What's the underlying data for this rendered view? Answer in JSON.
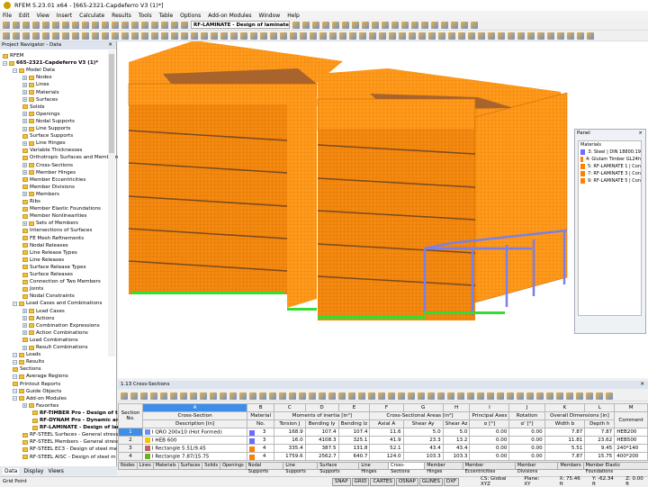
{
  "window": {
    "title": "RFEM 5.23.01 x64 - [665-2321-Capdeferro V3 (1)*]"
  },
  "menu": [
    "File",
    "Edit",
    "View",
    "Insert",
    "Calculate",
    "Results",
    "Tools",
    "Table",
    "Options",
    "Add-on Modules",
    "Window",
    "Help"
  ],
  "toolbar": {
    "module_select": "RF-LAMINATE - Design of laminate surf"
  },
  "navigator": {
    "title": "Project Navigator - Data",
    "tabs": [
      "Data",
      "Display",
      "Views"
    ],
    "tree": [
      {
        "l": 0,
        "t": "RFEM"
      },
      {
        "l": 0,
        "t": "665-2321-Capdeferro V3 (1)*",
        "b": true,
        "e": 1
      },
      {
        "l": 1,
        "t": "Model Data",
        "e": 1
      },
      {
        "l": 2,
        "t": "Nodes",
        "e": 1
      },
      {
        "l": 2,
        "t": "Lines",
        "e": 1
      },
      {
        "l": 2,
        "t": "Materials",
        "e": 1
      },
      {
        "l": 2,
        "t": "Surfaces",
        "e": 1
      },
      {
        "l": 2,
        "t": "Solids"
      },
      {
        "l": 2,
        "t": "Openings",
        "e": 1
      },
      {
        "l": 2,
        "t": "Nodal Supports",
        "e": 1
      },
      {
        "l": 2,
        "t": "Line Supports",
        "e": 1
      },
      {
        "l": 2,
        "t": "Surface Supports"
      },
      {
        "l": 2,
        "t": "Line Hinges",
        "e": 1
      },
      {
        "l": 2,
        "t": "Variable Thicknesses"
      },
      {
        "l": 2,
        "t": "Orthotropic Surfaces and Membranes"
      },
      {
        "l": 2,
        "t": "Cross-Sections",
        "e": 1
      },
      {
        "l": 2,
        "t": "Member Hinges",
        "e": 1
      },
      {
        "l": 2,
        "t": "Member Eccentricities"
      },
      {
        "l": 2,
        "t": "Member Divisions"
      },
      {
        "l": 2,
        "t": "Members",
        "e": 1
      },
      {
        "l": 2,
        "t": "Ribs"
      },
      {
        "l": 2,
        "t": "Member Elastic Foundations"
      },
      {
        "l": 2,
        "t": "Member Nonlinearities"
      },
      {
        "l": 2,
        "t": "Sets of Members",
        "e": 1
      },
      {
        "l": 2,
        "t": "Intersections of Surfaces"
      },
      {
        "l": 2,
        "t": "FE Mesh Refinements"
      },
      {
        "l": 2,
        "t": "Nodal Releases"
      },
      {
        "l": 2,
        "t": "Line Release Types"
      },
      {
        "l": 2,
        "t": "Line Releases"
      },
      {
        "l": 2,
        "t": "Surface Release Types"
      },
      {
        "l": 2,
        "t": "Surface Releases"
      },
      {
        "l": 2,
        "t": "Connection of Two Members"
      },
      {
        "l": 2,
        "t": "Joints"
      },
      {
        "l": 2,
        "t": "Nodal Constraints"
      },
      {
        "l": 1,
        "t": "Load Cases and Combinations",
        "e": 1
      },
      {
        "l": 2,
        "t": "Load Cases",
        "e": 1
      },
      {
        "l": 2,
        "t": "Actions",
        "e": 1
      },
      {
        "l": 2,
        "t": "Combination Expressions",
        "e": 1
      },
      {
        "l": 2,
        "t": "Action Combinations",
        "e": 1
      },
      {
        "l": 2,
        "t": "Load Combinations"
      },
      {
        "l": 2,
        "t": "Result Combinations",
        "e": 1
      },
      {
        "l": 1,
        "t": "Loads",
        "e": 1
      },
      {
        "l": 1,
        "t": "Results",
        "e": 1
      },
      {
        "l": 1,
        "t": "Sections"
      },
      {
        "l": 1,
        "t": "Average Regions",
        "e": 1
      },
      {
        "l": 1,
        "t": "Printout Reports"
      },
      {
        "l": 1,
        "t": "Guide Objects",
        "e": 1
      },
      {
        "l": 1,
        "t": "Add-on Modules",
        "e": 1
      },
      {
        "l": 2,
        "t": "Favorites",
        "e": 1
      },
      {
        "l": 3,
        "t": "RF-TIMBER Pro - Design of timber",
        "b": true
      },
      {
        "l": 3,
        "t": "RF-DYNAM Pro - Dynamic analysis",
        "b": true
      },
      {
        "l": 3,
        "t": "RF-LAMINATE - Design of laminate",
        "b": true
      },
      {
        "l": 2,
        "t": "RF-STEEL Surfaces - General stress"
      },
      {
        "l": 2,
        "t": "RF-STEEL Members - General stress"
      },
      {
        "l": 2,
        "t": "RF-STEEL EC3 - Design of steel me"
      },
      {
        "l": 2,
        "t": "RF-STEEL AISC - Design of steel m"
      }
    ]
  },
  "panel": {
    "title": "Panel",
    "section": "Materials",
    "items": [
      {
        "label": "3: Steel | DIN 18800:19",
        "color": "#6b6bff"
      },
      {
        "label": "4: Glulam Timber GL24h",
        "color": "#ff8000"
      },
      {
        "label": "5: RF-LAMINATE 1 | Con",
        "color": "#ff8000"
      },
      {
        "label": "7: RF-LAMINATE 3 | Con",
        "color": "#ff8000"
      },
      {
        "label": "9: RF-LAMINATE 5 | Con",
        "color": "#ff8000"
      }
    ]
  },
  "table": {
    "title": "1.13 Cross-Sections",
    "letters": [
      "A",
      "B",
      "C",
      "D",
      "E",
      "F",
      "G",
      "H",
      "I",
      "J",
      "K",
      "L",
      "M"
    ],
    "groups": [
      "Section No.",
      "Cross-Section",
      "Material",
      "Moments of inertia [in⁴]",
      "Cross-Sectional Areas [in²]",
      "Principal Axes",
      "Rotation",
      "Overall Dimensions [in]",
      ""
    ],
    "subheaders": [
      "Description [in]",
      "No.",
      "Torsion J",
      "Bending Iy",
      "Bending Iz",
      "Axial A",
      "Shear Ay",
      "Shear Az",
      "α [°]",
      "α' [°]",
      "Width b",
      "Depth h",
      "Comment"
    ],
    "rows": [
      {
        "no": "1",
        "desc": "QRO 200x10 (Hot Formed)",
        "color": "#6e8ff0",
        "mat": "3",
        "matcolor": "#6b6bff",
        "v": [
          "168.9",
          "107.4",
          "107.4",
          "11.6",
          "5.0",
          "5.0",
          "0.00",
          "0.00",
          "7.87",
          "7.87",
          "HEB200"
        ]
      },
      {
        "no": "2",
        "desc": "HEB 600",
        "color": "#f5c400",
        "mat": "3",
        "matcolor": "#6b6bff",
        "v": [
          "16.0",
          "4108.3",
          "325.1",
          "41.9",
          "23.3",
          "13.2",
          "0.00",
          "0.00",
          "11.81",
          "23.62",
          "HEB500"
        ]
      },
      {
        "no": "3",
        "desc": "Rectangle 5.51/9.45",
        "color": "#c06060",
        "mat": "4",
        "matcolor": "#ff8000",
        "v": [
          "335.4",
          "387.5",
          "131.8",
          "52.1",
          "43.4",
          "43.4",
          "0.00",
          "0.00",
          "5.51",
          "9.45",
          "240*140"
        ]
      },
      {
        "no": "4",
        "desc": "Rectangle 7.87/15.75",
        "color": "#70b020",
        "mat": "4",
        "matcolor": "#ff8000",
        "v": [
          "1759.6",
          "2562.7",
          "640.7",
          "124.0",
          "103.3",
          "103.3",
          "0.00",
          "0.00",
          "7.87",
          "15.75",
          "400*200"
        ]
      }
    ],
    "tabs": [
      "Nodes",
      "Lines",
      "Materials",
      "Surfaces",
      "Solids",
      "Openings",
      "Nodal Supports",
      "Line Supports",
      "Surface Supports",
      "Line Hinges",
      "Cross-Sections",
      "Member Hinges",
      "Member Eccentricities",
      "Member Divisions",
      "Members",
      "Member Elastic Foundations"
    ],
    "active_tab": "Cross-Sections"
  },
  "status": {
    "left": "Grid Point",
    "toggles": [
      "SNAP",
      "GRID",
      "CARTES",
      "OSNAP",
      "GLINES",
      "DXF"
    ],
    "cs": "CS: Global XYZ",
    "plane": "Plane: XY",
    "x": "X: 75.46 ft",
    "y": "Y: -62.34 ft",
    "z": "Z: 0.00 ft"
  }
}
